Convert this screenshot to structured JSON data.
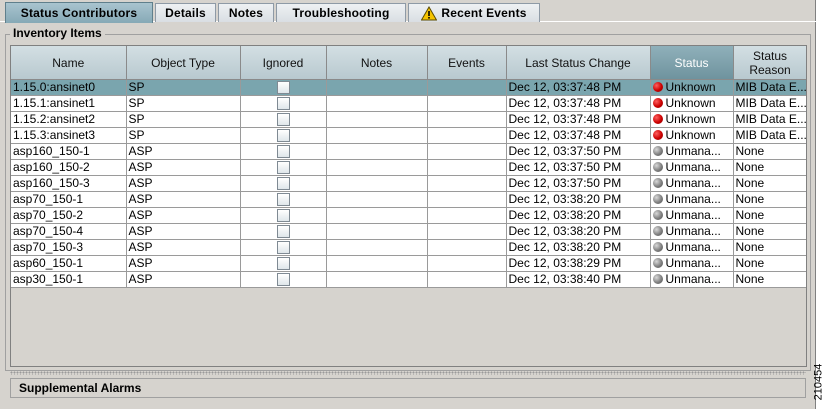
{
  "tabs": [
    {
      "label": "Status Contributors",
      "active": true
    },
    {
      "label": "Details"
    },
    {
      "label": "Notes"
    },
    {
      "label": "Troubleshooting"
    },
    {
      "label": "Recent Events",
      "icon": "warning-icon"
    }
  ],
  "inventory": {
    "title": "Inventory Items",
    "columns": [
      "Name",
      "Object Type",
      "Ignored",
      "Notes",
      "Events",
      "Last Status Change",
      "Status",
      "Status Reason"
    ],
    "rows": [
      {
        "name": "1.15.0:ansinet0",
        "type": "SP",
        "notes": "",
        "events": "",
        "last_change": "Dec 12, 03:37:48 PM",
        "status": "Unknown",
        "status_icon": "red-dot",
        "reason": "MIB Data E..."
      },
      {
        "name": "1.15.1:ansinet1",
        "type": "SP",
        "notes": "",
        "events": "",
        "last_change": "Dec 12, 03:37:48 PM",
        "status": "Unknown",
        "status_icon": "red-dot",
        "reason": "MIB Data E..."
      },
      {
        "name": "1.15.2:ansinet2",
        "type": "SP",
        "notes": "",
        "events": "",
        "last_change": "Dec 12, 03:37:48 PM",
        "status": "Unknown",
        "status_icon": "red-dot",
        "reason": "MIB Data E..."
      },
      {
        "name": "1.15.3:ansinet3",
        "type": "SP",
        "notes": "",
        "events": "",
        "last_change": "Dec 12, 03:37:48 PM",
        "status": "Unknown",
        "status_icon": "red-dot",
        "reason": "MIB Data E..."
      },
      {
        "name": "asp160_150-1",
        "type": "ASP",
        "notes": "",
        "events": "",
        "last_change": "Dec 12, 03:37:50 PM",
        "status": "Unmana...",
        "status_icon": "gray-dot",
        "reason": "None"
      },
      {
        "name": "asp160_150-2",
        "type": "ASP",
        "notes": "",
        "events": "",
        "last_change": "Dec 12, 03:37:50 PM",
        "status": "Unmana...",
        "status_icon": "gray-dot",
        "reason": "None"
      },
      {
        "name": "asp160_150-3",
        "type": "ASP",
        "notes": "",
        "events": "",
        "last_change": "Dec 12, 03:37:50 PM",
        "status": "Unmana...",
        "status_icon": "gray-dot",
        "reason": "None"
      },
      {
        "name": "asp70_150-1",
        "type": "ASP",
        "notes": "",
        "events": "",
        "last_change": "Dec 12, 03:38:20 PM",
        "status": "Unmana...",
        "status_icon": "gray-dot",
        "reason": "None"
      },
      {
        "name": "asp70_150-2",
        "type": "ASP",
        "notes": "",
        "events": "",
        "last_change": "Dec 12, 03:38:20 PM",
        "status": "Unmana...",
        "status_icon": "gray-dot",
        "reason": "None"
      },
      {
        "name": "asp70_150-4",
        "type": "ASP",
        "notes": "",
        "events": "",
        "last_change": "Dec 12, 03:38:20 PM",
        "status": "Unmana...",
        "status_icon": "gray-dot",
        "reason": "None"
      },
      {
        "name": "asp70_150-3",
        "type": "ASP",
        "notes": "",
        "events": "",
        "last_change": "Dec 12, 03:38:20 PM",
        "status": "Unmana...",
        "status_icon": "gray-dot",
        "reason": "None"
      },
      {
        "name": "asp60_150-1",
        "type": "ASP",
        "notes": "",
        "events": "",
        "last_change": "Dec 12, 03:38:29 PM",
        "status": "Unmana...",
        "status_icon": "gray-dot",
        "reason": "None"
      },
      {
        "name": "asp30_150-1",
        "type": "ASP",
        "notes": "",
        "events": "",
        "last_change": "Dec 12, 03:38:40 PM",
        "status": "Unmana...",
        "status_icon": "gray-dot",
        "reason": "None"
      }
    ]
  },
  "supplemental": {
    "title": "Supplemental Alarms"
  },
  "figure_id": "210454",
  "colors": {
    "selected_row": "#7aa5ae",
    "active_tab": "#86a9b6",
    "status_unknown": "#cc0000",
    "status_unmanaged": "#808080"
  }
}
